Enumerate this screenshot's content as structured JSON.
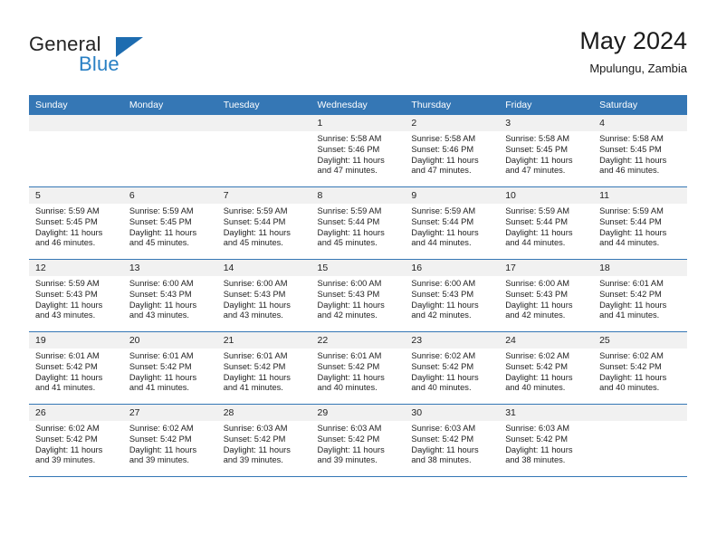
{
  "brand": {
    "name_top": "General",
    "name_bottom": "Blue",
    "accent_color": "#2980c4",
    "triangle_color": "#1d6cb0"
  },
  "header": {
    "title": "May 2024",
    "subtitle": "Mpulungu, Zambia"
  },
  "theme": {
    "header_bg": "#3577b5",
    "daynum_bg": "#f1f1f1",
    "text": "#222222"
  },
  "weekdays": [
    "Sunday",
    "Monday",
    "Tuesday",
    "Wednesday",
    "Thursday",
    "Friday",
    "Saturday"
  ],
  "weeks": [
    [
      {
        "day": "",
        "sunrise": "",
        "sunset": "",
        "daylight_line1": "",
        "daylight_line2": ""
      },
      {
        "day": "",
        "sunrise": "",
        "sunset": "",
        "daylight_line1": "",
        "daylight_line2": ""
      },
      {
        "day": "",
        "sunrise": "",
        "sunset": "",
        "daylight_line1": "",
        "daylight_line2": ""
      },
      {
        "day": "1",
        "sunrise": "Sunrise: 5:58 AM",
        "sunset": "Sunset: 5:46 PM",
        "daylight_line1": "Daylight: 11 hours",
        "daylight_line2": "and 47 minutes."
      },
      {
        "day": "2",
        "sunrise": "Sunrise: 5:58 AM",
        "sunset": "Sunset: 5:46 PM",
        "daylight_line1": "Daylight: 11 hours",
        "daylight_line2": "and 47 minutes."
      },
      {
        "day": "3",
        "sunrise": "Sunrise: 5:58 AM",
        "sunset": "Sunset: 5:45 PM",
        "daylight_line1": "Daylight: 11 hours",
        "daylight_line2": "and 47 minutes."
      },
      {
        "day": "4",
        "sunrise": "Sunrise: 5:58 AM",
        "sunset": "Sunset: 5:45 PM",
        "daylight_line1": "Daylight: 11 hours",
        "daylight_line2": "and 46 minutes."
      }
    ],
    [
      {
        "day": "5",
        "sunrise": "Sunrise: 5:59 AM",
        "sunset": "Sunset: 5:45 PM",
        "daylight_line1": "Daylight: 11 hours",
        "daylight_line2": "and 46 minutes."
      },
      {
        "day": "6",
        "sunrise": "Sunrise: 5:59 AM",
        "sunset": "Sunset: 5:45 PM",
        "daylight_line1": "Daylight: 11 hours",
        "daylight_line2": "and 45 minutes."
      },
      {
        "day": "7",
        "sunrise": "Sunrise: 5:59 AM",
        "sunset": "Sunset: 5:44 PM",
        "daylight_line1": "Daylight: 11 hours",
        "daylight_line2": "and 45 minutes."
      },
      {
        "day": "8",
        "sunrise": "Sunrise: 5:59 AM",
        "sunset": "Sunset: 5:44 PM",
        "daylight_line1": "Daylight: 11 hours",
        "daylight_line2": "and 45 minutes."
      },
      {
        "day": "9",
        "sunrise": "Sunrise: 5:59 AM",
        "sunset": "Sunset: 5:44 PM",
        "daylight_line1": "Daylight: 11 hours",
        "daylight_line2": "and 44 minutes."
      },
      {
        "day": "10",
        "sunrise": "Sunrise: 5:59 AM",
        "sunset": "Sunset: 5:44 PM",
        "daylight_line1": "Daylight: 11 hours",
        "daylight_line2": "and 44 minutes."
      },
      {
        "day": "11",
        "sunrise": "Sunrise: 5:59 AM",
        "sunset": "Sunset: 5:44 PM",
        "daylight_line1": "Daylight: 11 hours",
        "daylight_line2": "and 44 minutes."
      }
    ],
    [
      {
        "day": "12",
        "sunrise": "Sunrise: 5:59 AM",
        "sunset": "Sunset: 5:43 PM",
        "daylight_line1": "Daylight: 11 hours",
        "daylight_line2": "and 43 minutes."
      },
      {
        "day": "13",
        "sunrise": "Sunrise: 6:00 AM",
        "sunset": "Sunset: 5:43 PM",
        "daylight_line1": "Daylight: 11 hours",
        "daylight_line2": "and 43 minutes."
      },
      {
        "day": "14",
        "sunrise": "Sunrise: 6:00 AM",
        "sunset": "Sunset: 5:43 PM",
        "daylight_line1": "Daylight: 11 hours",
        "daylight_line2": "and 43 minutes."
      },
      {
        "day": "15",
        "sunrise": "Sunrise: 6:00 AM",
        "sunset": "Sunset: 5:43 PM",
        "daylight_line1": "Daylight: 11 hours",
        "daylight_line2": "and 42 minutes."
      },
      {
        "day": "16",
        "sunrise": "Sunrise: 6:00 AM",
        "sunset": "Sunset: 5:43 PM",
        "daylight_line1": "Daylight: 11 hours",
        "daylight_line2": "and 42 minutes."
      },
      {
        "day": "17",
        "sunrise": "Sunrise: 6:00 AM",
        "sunset": "Sunset: 5:43 PM",
        "daylight_line1": "Daylight: 11 hours",
        "daylight_line2": "and 42 minutes."
      },
      {
        "day": "18",
        "sunrise": "Sunrise: 6:01 AM",
        "sunset": "Sunset: 5:42 PM",
        "daylight_line1": "Daylight: 11 hours",
        "daylight_line2": "and 41 minutes."
      }
    ],
    [
      {
        "day": "19",
        "sunrise": "Sunrise: 6:01 AM",
        "sunset": "Sunset: 5:42 PM",
        "daylight_line1": "Daylight: 11 hours",
        "daylight_line2": "and 41 minutes."
      },
      {
        "day": "20",
        "sunrise": "Sunrise: 6:01 AM",
        "sunset": "Sunset: 5:42 PM",
        "daylight_line1": "Daylight: 11 hours",
        "daylight_line2": "and 41 minutes."
      },
      {
        "day": "21",
        "sunrise": "Sunrise: 6:01 AM",
        "sunset": "Sunset: 5:42 PM",
        "daylight_line1": "Daylight: 11 hours",
        "daylight_line2": "and 41 minutes."
      },
      {
        "day": "22",
        "sunrise": "Sunrise: 6:01 AM",
        "sunset": "Sunset: 5:42 PM",
        "daylight_line1": "Daylight: 11 hours",
        "daylight_line2": "and 40 minutes."
      },
      {
        "day": "23",
        "sunrise": "Sunrise: 6:02 AM",
        "sunset": "Sunset: 5:42 PM",
        "daylight_line1": "Daylight: 11 hours",
        "daylight_line2": "and 40 minutes."
      },
      {
        "day": "24",
        "sunrise": "Sunrise: 6:02 AM",
        "sunset": "Sunset: 5:42 PM",
        "daylight_line1": "Daylight: 11 hours",
        "daylight_line2": "and 40 minutes."
      },
      {
        "day": "25",
        "sunrise": "Sunrise: 6:02 AM",
        "sunset": "Sunset: 5:42 PM",
        "daylight_line1": "Daylight: 11 hours",
        "daylight_line2": "and 40 minutes."
      }
    ],
    [
      {
        "day": "26",
        "sunrise": "Sunrise: 6:02 AM",
        "sunset": "Sunset: 5:42 PM",
        "daylight_line1": "Daylight: 11 hours",
        "daylight_line2": "and 39 minutes."
      },
      {
        "day": "27",
        "sunrise": "Sunrise: 6:02 AM",
        "sunset": "Sunset: 5:42 PM",
        "daylight_line1": "Daylight: 11 hours",
        "daylight_line2": "and 39 minutes."
      },
      {
        "day": "28",
        "sunrise": "Sunrise: 6:03 AM",
        "sunset": "Sunset: 5:42 PM",
        "daylight_line1": "Daylight: 11 hours",
        "daylight_line2": "and 39 minutes."
      },
      {
        "day": "29",
        "sunrise": "Sunrise: 6:03 AM",
        "sunset": "Sunset: 5:42 PM",
        "daylight_line1": "Daylight: 11 hours",
        "daylight_line2": "and 39 minutes."
      },
      {
        "day": "30",
        "sunrise": "Sunrise: 6:03 AM",
        "sunset": "Sunset: 5:42 PM",
        "daylight_line1": "Daylight: 11 hours",
        "daylight_line2": "and 38 minutes."
      },
      {
        "day": "31",
        "sunrise": "Sunrise: 6:03 AM",
        "sunset": "Sunset: 5:42 PM",
        "daylight_line1": "Daylight: 11 hours",
        "daylight_line2": "and 38 minutes."
      },
      {
        "day": "",
        "sunrise": "",
        "sunset": "",
        "daylight_line1": "",
        "daylight_line2": ""
      }
    ]
  ]
}
